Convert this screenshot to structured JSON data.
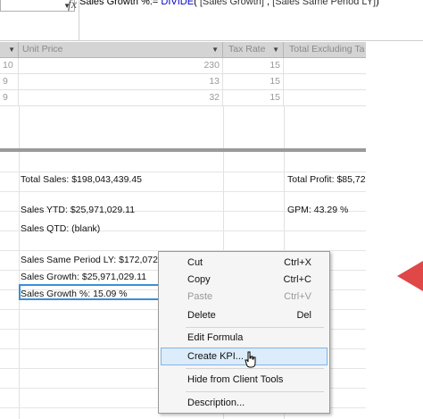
{
  "formula_bar": {
    "fx": "fx",
    "measure_name": "Sales Growth %:= ",
    "function": "DIVIDE",
    "open": "( ",
    "arg1": "[Sales Growth]",
    "sep": " , ",
    "arg2": "[Sales Same Period LY]",
    "close": ")"
  },
  "columns": [
    {
      "label": "Unit Price"
    },
    {
      "label": "Tax Rate"
    },
    {
      "label": "Total Excluding Ta"
    }
  ],
  "rows": [
    {
      "lead": "10",
      "unit_price": "230",
      "tax_rate": "15"
    },
    {
      "lead": "9",
      "unit_price": "13",
      "tax_rate": "15"
    },
    {
      "lead": "9",
      "unit_price": "32",
      "tax_rate": "15"
    }
  ],
  "measures": {
    "total_sales": "Total Sales: $198,043,439.45",
    "total_profit": "Total Profit: $85,72",
    "sales_ytd": "Sales YTD: $25,971,029.11",
    "gpm": "GPM: 43.29 %",
    "sales_qtd": "Sales QTD: (blank)",
    "sales_same_period_ly": "Sales Same Period LY: $172,072,410.34",
    "sales_growth": "Sales Growth: $25,971,029.11",
    "sales_growth_pct": "Sales Growth %: 15.09 %"
  },
  "context_menu": {
    "items": [
      {
        "label": "Cut",
        "shortcut": "Ctrl+X"
      },
      {
        "label": "Copy",
        "shortcut": "Ctrl+C"
      },
      {
        "label": "Paste",
        "shortcut": "Ctrl+V"
      },
      {
        "label": "Delete",
        "shortcut": "Del"
      },
      {
        "label": "Edit Formula",
        "shortcut": ""
      },
      {
        "label": "Create KPI...",
        "shortcut": ""
      },
      {
        "label": "Hide from Client Tools",
        "shortcut": ""
      },
      {
        "label": "Description...",
        "shortcut": ""
      }
    ]
  },
  "colors": {
    "selection_border": "#3b8fd8",
    "menu_highlight": "#dcecfb",
    "annotation_arrow": "#e04848"
  }
}
